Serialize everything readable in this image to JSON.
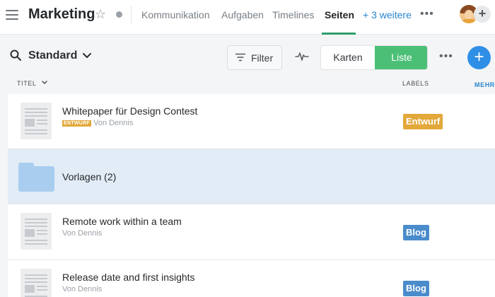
{
  "topbar": {
    "title": "Marketing",
    "tabs": [
      {
        "label": "Kommunikation"
      },
      {
        "label": "Aufgaben"
      },
      {
        "label": "Timelines"
      },
      {
        "label": "Seiten",
        "active": true
      }
    ],
    "more_tabs_label": "+ 3 weitere",
    "overflow_label": "•••",
    "add_label": "+"
  },
  "toolbar": {
    "view_name": "Standard",
    "filter_label": "Filter",
    "view_modes": {
      "cards": "Karten",
      "list": "Liste",
      "selected": "list"
    },
    "overflow_label": "•••",
    "add_label": "+"
  },
  "columns": {
    "title": "TITEL",
    "labels": "LABELS",
    "more": "MEHR"
  },
  "rows": [
    {
      "type": "page",
      "title": "Whitepaper für Design Contest",
      "status_tag": "ENTWURF",
      "author": "Von Dennis",
      "label": "Entwurf"
    },
    {
      "type": "folder",
      "title": "Vorlagen (2)"
    },
    {
      "type": "page",
      "title": "Remote work within a team",
      "author": "Von Dennis",
      "label": "Blog"
    },
    {
      "type": "page",
      "title": "Release date and first insights",
      "author": "Von Dennis",
      "label": "Blog"
    }
  ],
  "colors": {
    "accent_green": "#4bbf76",
    "active_tab_underline": "#2f9e6d",
    "primary_blue": "#2f8fe6",
    "link_blue": "#2a87d0",
    "label_entwurf": "#e2a83a",
    "label_blog": "#4a8ccb",
    "folder_row_bg": "#e1ecf6"
  }
}
